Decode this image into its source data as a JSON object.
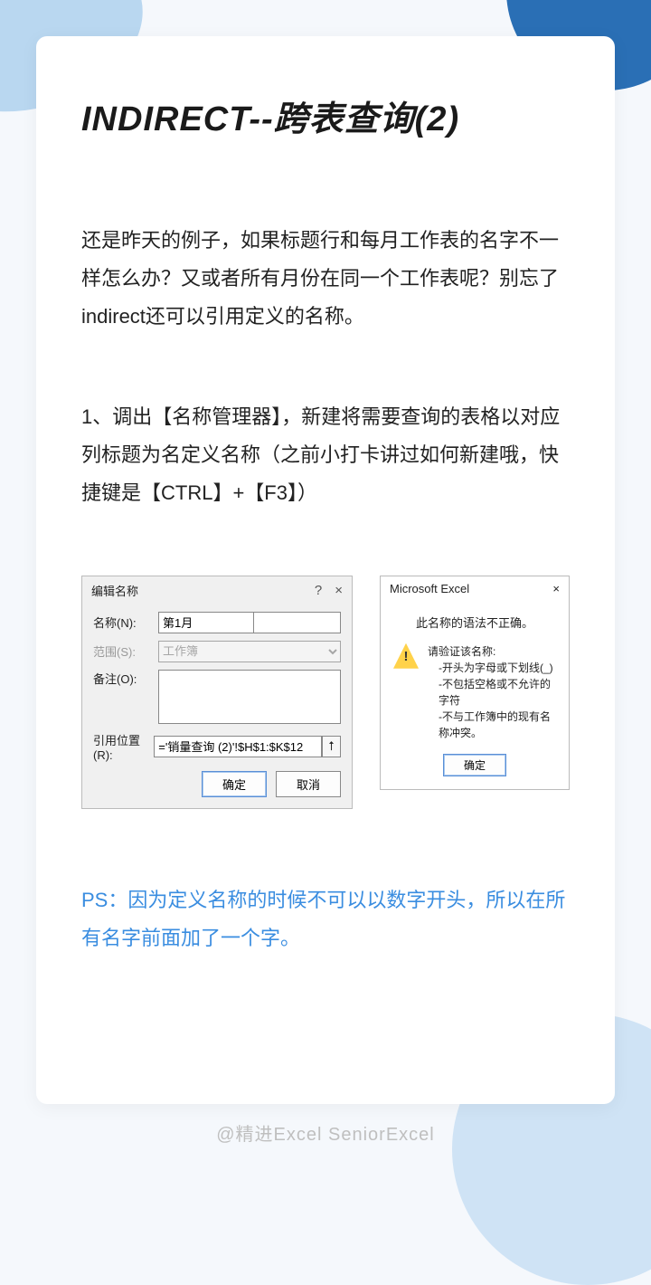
{
  "title": "INDIRECT--跨表查询(2)",
  "intro": "还是昨天的例子，如果标题行和每月工作表的名字不一样怎么办？又或者所有月份在同一个工作表呢？别忘了indirect还可以引用定义的名称。",
  "step1": "1、调出【名称管理器】，新建将需要查询的表格以对应列标题为名定义名称（之前小打卡讲过如何新建哦，快捷键是【CTRL】+【F3】）",
  "editDialog": {
    "title": "编辑名称",
    "help": "?",
    "close": "×",
    "nameLabel": "名称(N):",
    "nameValue": "第1月",
    "scopeLabel": "范围(S):",
    "scopeValue": "工作簿",
    "commentLabel": "备注(O):",
    "refLabel": "引用位置(R):",
    "refValue": "='销量查询 (2)'!$H$1:$K$12",
    "ok": "确定",
    "cancel": "取消"
  },
  "errorDialog": {
    "title": "Microsoft Excel",
    "close": "×",
    "line1": "此名称的语法不正确。",
    "line2": "请验证该名称:",
    "bullet1": "-开头为字母或下划线(_)",
    "bullet2": "-不包括空格或不允许的字符",
    "bullet3": "-不与工作簿中的现有名称冲突。",
    "ok": "确定"
  },
  "ps": "PS：因为定义名称的时候不可以以数字开头，所以在所有名字前面加了一个字。",
  "credit": "@精进Excel    SeniorExcel"
}
